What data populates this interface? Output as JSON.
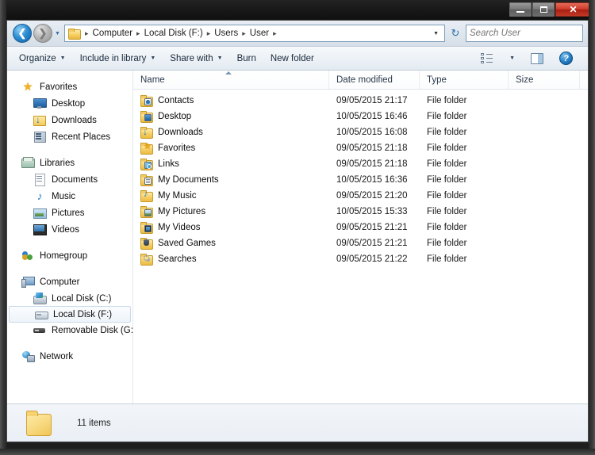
{
  "window": {
    "controls": {
      "minimize": "Minimize",
      "maximize": "Maximize",
      "close": "Close"
    }
  },
  "address": {
    "back_label": "Back",
    "forward_label": "Forward",
    "history_label": "Recent pages",
    "crumbs": [
      "Computer",
      "Local Disk (F:)",
      "Users",
      "User"
    ],
    "separator": "▸",
    "dropdown": "▼",
    "refresh": "↻"
  },
  "search": {
    "placeholder": "Search User",
    "value": "",
    "icon": "search-icon"
  },
  "toolbar": {
    "items": [
      {
        "label": "Organize",
        "has_caret": true
      },
      {
        "label": "Include in library",
        "has_caret": true
      },
      {
        "label": "Share with",
        "has_caret": true
      },
      {
        "label": "Burn",
        "has_caret": false
      },
      {
        "label": "New folder",
        "has_caret": false
      }
    ],
    "caret": "▼",
    "views_icon": "view-options-icon",
    "pane_icon": "preview-pane-icon",
    "help_icon": "help-icon",
    "help_glyph": "?"
  },
  "sidebar": {
    "groups": [
      {
        "root": {
          "label": "Favorites",
          "icon": "star-icon"
        },
        "children": [
          {
            "label": "Desktop",
            "icon": "desktop-icon",
            "selected": false
          },
          {
            "label": "Downloads",
            "icon": "downloads-icon",
            "selected": false
          },
          {
            "label": "Recent Places",
            "icon": "recent-places-icon",
            "selected": false
          }
        ]
      },
      {
        "root": {
          "label": "Libraries",
          "icon": "libraries-icon"
        },
        "children": [
          {
            "label": "Documents",
            "icon": "documents-icon",
            "selected": false
          },
          {
            "label": "Music",
            "icon": "music-icon",
            "selected": false
          },
          {
            "label": "Pictures",
            "icon": "pictures-icon",
            "selected": false
          },
          {
            "label": "Videos",
            "icon": "videos-icon",
            "selected": false
          }
        ]
      },
      {
        "root": {
          "label": "Homegroup",
          "icon": "homegroup-icon"
        },
        "children": []
      },
      {
        "root": {
          "label": "Computer",
          "icon": "computer-icon"
        },
        "children": [
          {
            "label": "Local Disk (C:)",
            "icon": "hard-disk-system-icon",
            "selected": false
          },
          {
            "label": "Local Disk (F:)",
            "icon": "hard-disk-icon",
            "selected": true
          },
          {
            "label": "Removable Disk (G:)",
            "icon": "removable-disk-icon",
            "selected": false
          }
        ]
      },
      {
        "root": {
          "label": "Network",
          "icon": "network-icon"
        },
        "children": []
      }
    ]
  },
  "filelist": {
    "columns": [
      {
        "key": "name",
        "label": "Name",
        "sorted": "asc"
      },
      {
        "key": "date",
        "label": "Date modified",
        "sorted": null
      },
      {
        "key": "type",
        "label": "Type",
        "sorted": null
      },
      {
        "key": "size",
        "label": "Size",
        "sorted": null
      }
    ],
    "rows": [
      {
        "name": "Contacts",
        "date": "09/05/2015 21:17",
        "type": "File folder",
        "size": "",
        "icon": "folder-contacts-icon"
      },
      {
        "name": "Desktop",
        "date": "10/05/2015 16:46",
        "type": "File folder",
        "size": "",
        "icon": "folder-desktop-icon"
      },
      {
        "name": "Downloads",
        "date": "10/05/2015 16:08",
        "type": "File folder",
        "size": "",
        "icon": "folder-downloads-icon"
      },
      {
        "name": "Favorites",
        "date": "09/05/2015 21:18",
        "type": "File folder",
        "size": "",
        "icon": "folder-favorites-icon"
      },
      {
        "name": "Links",
        "date": "09/05/2015 21:18",
        "type": "File folder",
        "size": "",
        "icon": "folder-links-icon"
      },
      {
        "name": "My Documents",
        "date": "10/05/2015 16:36",
        "type": "File folder",
        "size": "",
        "icon": "folder-documents-icon"
      },
      {
        "name": "My Music",
        "date": "09/05/2015 21:20",
        "type": "File folder",
        "size": "",
        "icon": "folder-music-icon"
      },
      {
        "name": "My Pictures",
        "date": "10/05/2015 15:33",
        "type": "File folder",
        "size": "",
        "icon": "folder-pictures-icon"
      },
      {
        "name": "My Videos",
        "date": "09/05/2015 21:21",
        "type": "File folder",
        "size": "",
        "icon": "folder-videos-icon"
      },
      {
        "name": "Saved Games",
        "date": "09/05/2015 21:21",
        "type": "File folder",
        "size": "",
        "icon": "folder-saved-games-icon"
      },
      {
        "name": "Searches",
        "date": "09/05/2015 21:22",
        "type": "File folder",
        "size": "",
        "icon": "folder-searches-icon"
      }
    ]
  },
  "statusbar": {
    "item_count": "11 items",
    "icon": "folder-icon"
  },
  "colors": {
    "accent": "#2f8fd4",
    "folder_yellow": "#f6cf63",
    "close_red": "#cf3b28",
    "titlebar": "#181818",
    "chrome": "#e8eef4"
  }
}
